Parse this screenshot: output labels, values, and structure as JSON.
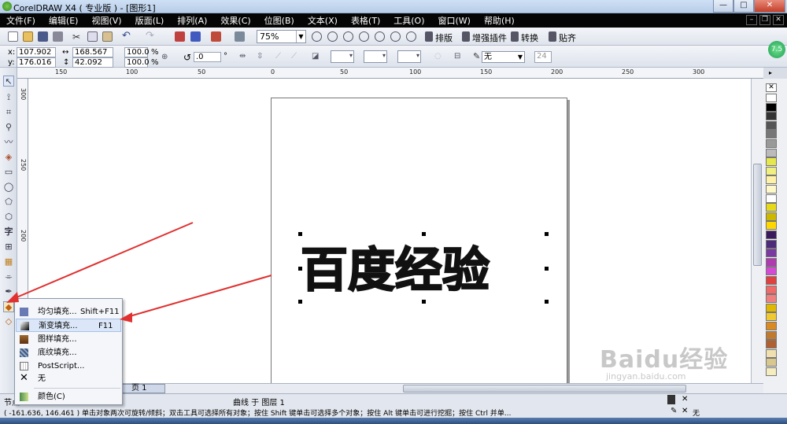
{
  "window": {
    "title": "CorelDRAW X4 ( 专业版 ) - [图形1]",
    "min": "—",
    "max": "□",
    "close": "✕"
  },
  "menu": [
    "文件(F)",
    "编辑(E)",
    "视图(V)",
    "版面(L)",
    "排列(A)",
    "效果(C)",
    "位图(B)",
    "文本(X)",
    "表格(T)",
    "工具(O)",
    "窗口(W)",
    "帮助(H)"
  ],
  "standard_toolbar": {
    "zoom": "75%",
    "plugin_labels": [
      "排版",
      "增强插件",
      "转换",
      "贴齐"
    ]
  },
  "property_bar": {
    "x": "107.902 mm",
    "y": "176.016 mm",
    "width": "168.567 mm",
    "height": "42.092 mm",
    "scale_x": "100.0",
    "scale_y": "100.0",
    "percent": "%",
    "rotation": ".0",
    "degree": "°",
    "outline_width": "无",
    "font_size": "24"
  },
  "rulers": {
    "h_ticks": [
      "150",
      "100",
      "50",
      "0",
      "50",
      "100",
      "150",
      "200",
      "250",
      "300"
    ],
    "v_ticks": [
      "300",
      "250",
      "200"
    ]
  },
  "canvas": {
    "artwork_text": "百度经验"
  },
  "fill_flyout": {
    "items": [
      {
        "label": "均匀填充...",
        "shortcut": "Shift+F11",
        "icon": "uniform-fill-icon",
        "color": "#6a7ab4"
      },
      {
        "label": "渐变填充...",
        "shortcut": "F11",
        "icon": "gradient-fill-icon",
        "color": "#333333"
      },
      {
        "label": "图样填充...",
        "shortcut": "",
        "icon": "pattern-fill-icon",
        "color": "#7a4e2a"
      },
      {
        "label": "底纹填充...",
        "shortcut": "",
        "icon": "texture-fill-icon",
        "color": "#3a5a8a"
      },
      {
        "label": "PostScript...",
        "shortcut": "",
        "icon": "postscript-fill-icon",
        "color": "#888888"
      },
      {
        "label": "无",
        "shortcut": "",
        "icon": "no-fill-icon",
        "color": "#333333"
      },
      {
        "label": "颜色(C)",
        "shortcut": "",
        "icon": "color-docker-icon",
        "color": "#4a8a4a"
      }
    ],
    "selected_index": 1
  },
  "page_tab": "页 1",
  "status": {
    "line1_left": "节点",
    "line1_center": "曲线 于 图层 1",
    "line2": "( -161.636, 146.461 )  单击对象两次可旋转/倾斜；双击工具可选择所有对象；按住 Shift 键单击可选择多个对象；按住 Alt 键单击可进行挖掘；按住 Ctrl 并单...",
    "fill_none": "无"
  },
  "palette_colors": [
    "#ffffff",
    "#000000",
    "#333333",
    "#555555",
    "#777777",
    "#999999",
    "#bbbbbb",
    "#e6e64d",
    "#f0f080",
    "#fff2a8",
    "#fff8c8",
    "#ffffff",
    "#e6d91a",
    "#ccb800",
    "#ffd700",
    "#3a1a5a",
    "#4d2a7a",
    "#7a3aa0",
    "#b03ab0",
    "#d44ad4",
    "#e04040",
    "#f06a6a",
    "#f08080",
    "#e0b800",
    "#f0c830",
    "#d98a20",
    "#c07a30",
    "#b06030",
    "#f0e0b0",
    "#d8c890",
    "#f5ecc0"
  ],
  "watermark": {
    "text": "Baidu经验",
    "url": "jingyan.baidu.com"
  },
  "accent": {
    "arrow": "#e03030",
    "menubar": "#050505"
  }
}
